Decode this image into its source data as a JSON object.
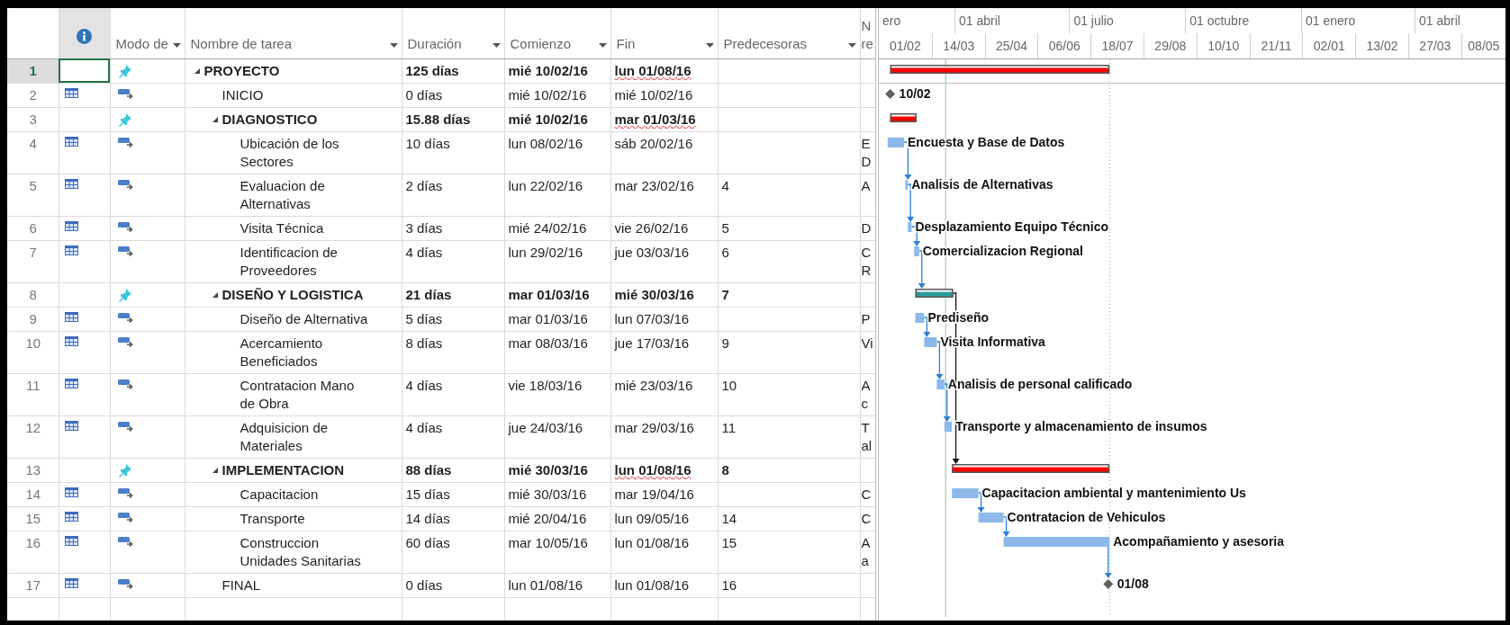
{
  "columns": [
    {
      "kind": "indicator"
    },
    {
      "kind": "text",
      "label": "Modo de",
      "filter": true
    },
    {
      "kind": "text",
      "label": "Nombre de tarea",
      "filter": true
    },
    {
      "kind": "text",
      "label": "Duración",
      "filter": true
    },
    {
      "kind": "text",
      "label": "Comienzo",
      "filter": true
    },
    {
      "kind": "text",
      "label": "Fin",
      "filter": true
    },
    {
      "kind": "text",
      "label": "Predecesoras",
      "filter": true
    },
    {
      "kind": "text",
      "label": "N re",
      "filter": false
    }
  ],
  "timescale": {
    "top": [
      "ero",
      "01 abril",
      "01 julio",
      "01 octubre",
      "01 enero",
      "01 abril"
    ],
    "bottom": [
      "01/02",
      "14/03",
      "25/04",
      "06/06",
      "18/07",
      "29/08",
      "10/10",
      "21/11",
      "02/01",
      "13/02",
      "27/03",
      "08/05"
    ]
  },
  "tasks": [
    {
      "id": "1",
      "name": "PROYECTO",
      "kind": "summary",
      "manual": true,
      "calendar": false,
      "selected": true,
      "expanded": true,
      "critical": true,
      "duration": "125 días",
      "start": "mié 10/02/16",
      "finish": "lun 01/08/16",
      "finish_flagged": true,
      "children": [
        {
          "id": "2",
          "name": "INICIO",
          "kind": "milestone",
          "manual": false,
          "calendar": true,
          "selected": false,
          "duration": "0 días",
          "start": "mié 10/02/16",
          "finish": "mié 10/02/16",
          "finish_flagged": false,
          "bar_label": "10/02"
        },
        {
          "id": "3",
          "name": "DIAGNOSTICO",
          "kind": "summary",
          "manual": true,
          "calendar": false,
          "selected": false,
          "expanded": true,
          "critical": true,
          "duration": "15.88 días",
          "start": "mié 10/02/16",
          "finish": "mar 01/03/16",
          "finish_flagged": true,
          "children": [
            {
              "id": "4",
              "name": "Ubicación de los Sectores",
              "kind": "task",
              "manual": false,
              "calendar": true,
              "selected": false,
              "duration": "10 días",
              "start": "lun 08/02/16",
              "finish": "sáb 20/02/16",
              "finish_flagged": false,
              "resources": "E D",
              "bar_label": "Encuesta y Base de Datos"
            },
            {
              "id": "5",
              "name": "Evaluacion de Alternativas",
              "kind": "task",
              "manual": false,
              "calendar": true,
              "selected": false,
              "duration": "2 días",
              "start": "lun 22/02/16",
              "finish": "mar 23/02/16",
              "finish_flagged": false,
              "predecessors": "4",
              "resources": "A",
              "bar_label": "Analisis de Alternativas"
            },
            {
              "id": "6",
              "name": "Visita Técnica",
              "kind": "task",
              "manual": false,
              "calendar": true,
              "selected": false,
              "duration": "3 días",
              "start": "mié 24/02/16",
              "finish": "vie 26/02/16",
              "finish_flagged": false,
              "predecessors": "5",
              "resources": "D",
              "bar_label": "Desplazamiento Equipo Técnico"
            },
            {
              "id": "7",
              "name": "Identificacion de Proveedores",
              "kind": "task",
              "manual": false,
              "calendar": true,
              "selected": false,
              "duration": "4 días",
              "start": "lun 29/02/16",
              "finish": "jue 03/03/16",
              "finish_flagged": false,
              "predecessors": "6",
              "resources": "C R",
              "bar_label": "Comercializacion Regional"
            }
          ]
        },
        {
          "id": "8",
          "name": "DISEÑO Y LOGISTICA",
          "kind": "summary",
          "manual": true,
          "calendar": false,
          "selected": false,
          "expanded": true,
          "critical": false,
          "duration": "21 días",
          "start": "mar 01/03/16",
          "finish": "mié 30/03/16",
          "finish_flagged": false,
          "predecessors": "7",
          "children": [
            {
              "id": "9",
              "name": "Diseño de Alternativa",
              "kind": "task",
              "manual": false,
              "calendar": true,
              "selected": false,
              "duration": "5 días",
              "start": "mar 01/03/16",
              "finish": "lun 07/03/16",
              "finish_flagged": false,
              "resources": "P",
              "bar_label": "Prediseño"
            },
            {
              "id": "10",
              "name": "Acercamiento Beneficiados",
              "kind": "task",
              "manual": false,
              "calendar": true,
              "selected": false,
              "duration": "8 días",
              "start": "mar 08/03/16",
              "finish": "jue 17/03/16",
              "finish_flagged": false,
              "predecessors": "9",
              "resources": "Vi",
              "bar_label": "Visita Informativa"
            },
            {
              "id": "11",
              "name": "Contratacion Mano de Obra",
              "kind": "task",
              "manual": false,
              "calendar": true,
              "selected": false,
              "duration": "4 días",
              "start": "vie 18/03/16",
              "finish": "mié 23/03/16",
              "finish_flagged": false,
              "predecessors": "10",
              "resources": "A c",
              "bar_label": "Analisis de personal calificado"
            },
            {
              "id": "12",
              "name": "Adquisicion de Materiales",
              "kind": "task",
              "manual": false,
              "calendar": true,
              "selected": false,
              "duration": "4 días",
              "start": "jue 24/03/16",
              "finish": "mar 29/03/16",
              "finish_flagged": false,
              "predecessors": "11",
              "resources": "T al",
              "bar_label": "Transporte y almacenamiento de insumos"
            }
          ]
        },
        {
          "id": "13",
          "name": "IMPLEMENTACION",
          "kind": "summary",
          "manual": true,
          "calendar": false,
          "selected": false,
          "expanded": true,
          "critical": true,
          "duration": "88 días",
          "start": "mié 30/03/16",
          "finish": "lun 01/08/16",
          "finish_flagged": true,
          "predecessors": "8",
          "children": [
            {
              "id": "14",
              "name": "Capacitacion",
              "kind": "task",
              "manual": false,
              "calendar": true,
              "selected": false,
              "duration": "15 días",
              "start": "mié 30/03/16",
              "finish": "mar 19/04/16",
              "finish_flagged": false,
              "resources": "C",
              "bar_label": "Capacitacion ambiental y mantenimiento Us"
            },
            {
              "id": "15",
              "name": "Transporte",
              "kind": "task",
              "manual": false,
              "calendar": true,
              "selected": false,
              "duration": "14 días",
              "start": "mié 20/04/16",
              "finish": "lun 09/05/16",
              "finish_flagged": false,
              "predecessors": "14",
              "resources": "C",
              "bar_label": "Contratacion de Vehiculos"
            },
            {
              "id": "16",
              "name": "Construccion Unidades Sanitarias",
              "kind": "task",
              "manual": false,
              "calendar": true,
              "selected": false,
              "duration": "60 días",
              "start": "mar 10/05/16",
              "finish": "lun 01/08/16",
              "finish_flagged": false,
              "predecessors": "15",
              "resources": "A a",
              "bar_label": "Acompañamiento y asesoria"
            }
          ]
        },
        {
          "id": "17",
          "name": "FINAL",
          "kind": "milestone",
          "manual": false,
          "calendar": true,
          "selected": false,
          "duration": "0 días",
          "start": "lun 01/08/16",
          "finish": "lun 01/08/16",
          "finish_flagged": false,
          "predecessors": "16",
          "bar_label": "01/08"
        }
      ]
    }
  ]
}
